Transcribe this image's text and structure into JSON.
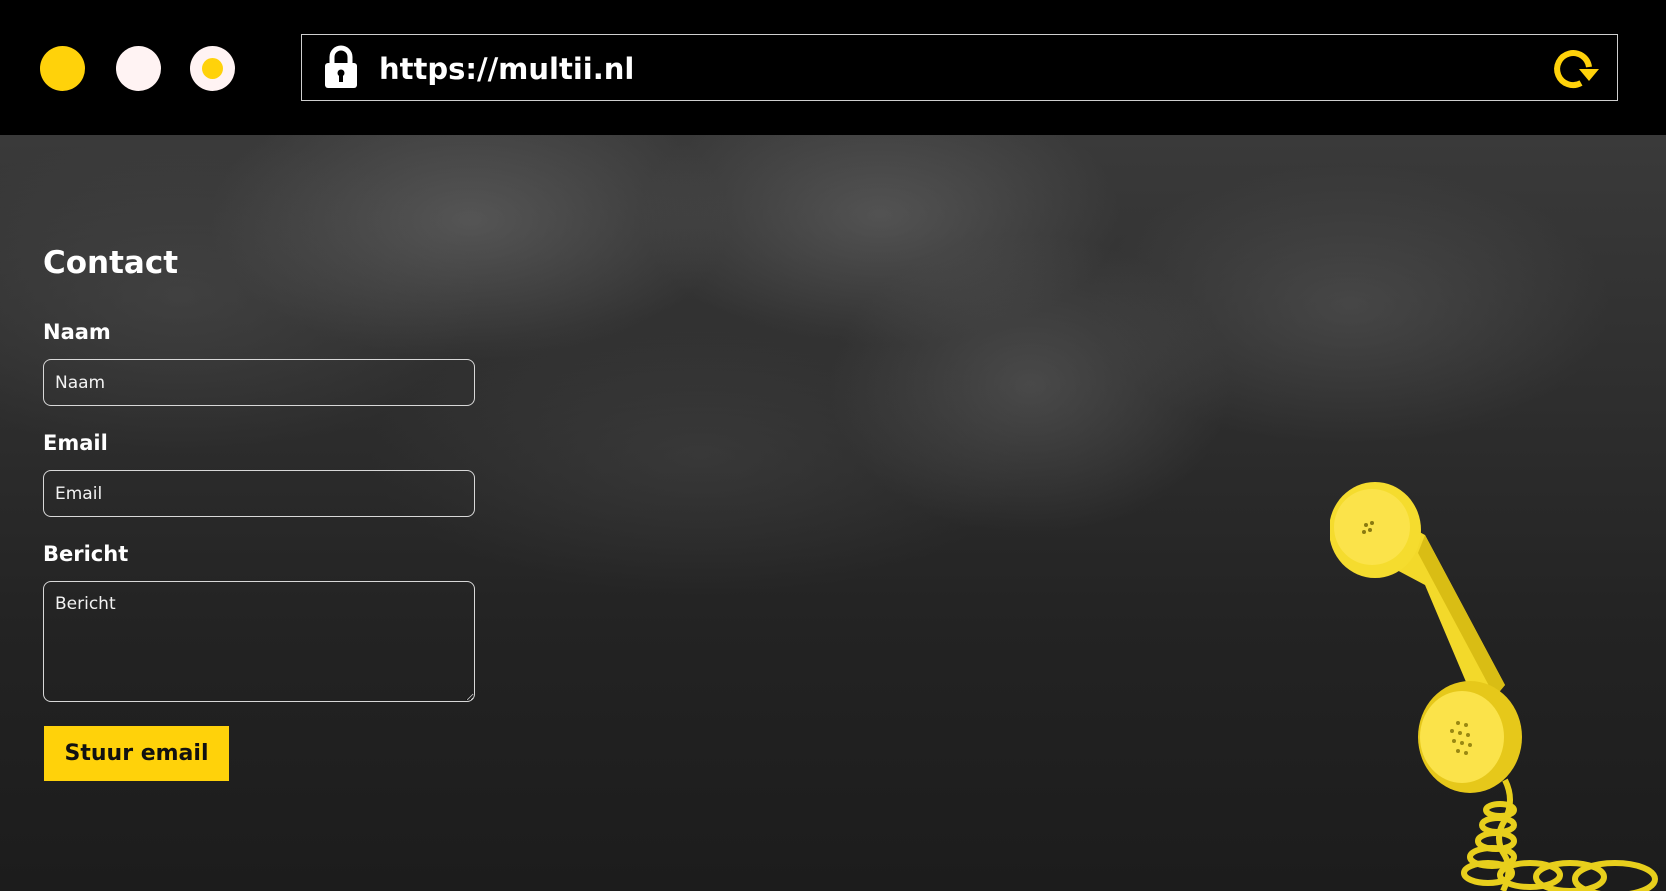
{
  "browser": {
    "url": "https://multii.nl",
    "window_dots": [
      "yellow",
      "white",
      "white-with-yellow-center"
    ],
    "icons": {
      "lock": "lock-icon",
      "reload": "reload-icon"
    }
  },
  "contact": {
    "title": "Contact",
    "fields": {
      "name": {
        "label": "Naam",
        "placeholder": "Naam",
        "value": ""
      },
      "email": {
        "label": "Email",
        "placeholder": "Email",
        "value": ""
      },
      "message": {
        "label": "Bericht",
        "placeholder": "Bericht",
        "value": ""
      }
    },
    "submit_label": "Stuur email"
  },
  "decor": {
    "image": "yellow-telephone-handset"
  },
  "colors": {
    "accent": "#ffd20a",
    "bar_background": "#000000",
    "text": "#ffffff"
  }
}
